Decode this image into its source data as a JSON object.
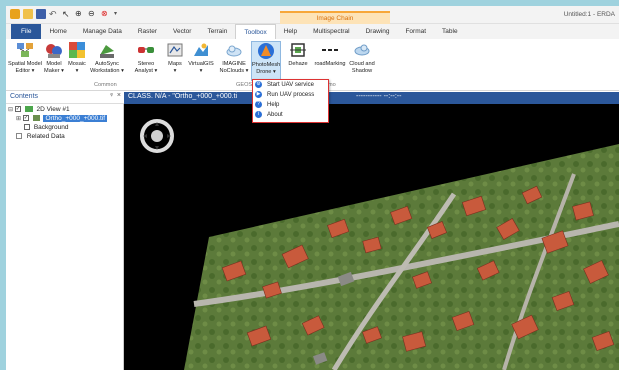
{
  "title_bar": {
    "context_tab": "Image Chain",
    "doc_title": "Untitled:1 - ERDA"
  },
  "tabs": [
    "File",
    "Home",
    "Manage Data",
    "Raster",
    "Vector",
    "Terrain",
    "Toolbox",
    "Help",
    "Multispectral",
    "Drawing",
    "Format",
    "Table"
  ],
  "active_tab": "Toolbox",
  "ribbon": {
    "buttons": [
      {
        "line1": "Spatial Model",
        "line2": "Editor ▾"
      },
      {
        "line1": "Model",
        "line2": "Maker ▾"
      },
      {
        "line1": "Mosaic",
        "line2": "▾"
      },
      {
        "line1": "AutoSync",
        "line2": "Workstation ▾"
      },
      {
        "line1": "Stereo",
        "line2": "Analyst ▾"
      },
      {
        "line1": "Maps",
        "line2": "▾"
      },
      {
        "line1": "VirtualGIS",
        "line2": "▾"
      },
      {
        "line1": "IMAGINE",
        "line2": "NoClouds ▾"
      },
      {
        "line1": "PhotoMesh",
        "line2": "Drone ▾"
      },
      {
        "line1": "Dehaze",
        "line2": ""
      },
      {
        "line1": "roadMarking",
        "line2": ""
      },
      {
        "line1": "Cloud and",
        "line2": "Shadow"
      }
    ],
    "groups": {
      "common": "Common",
      "geos": "GEOS",
      "demo": "mo"
    }
  },
  "contents": {
    "title": "Contents",
    "pin": "ᵠ",
    "close": "×",
    "view": "2D View #1",
    "layer": "Ortho_+000_+000.tif",
    "background": "Background",
    "related": "Related Data"
  },
  "viewbar": {
    "title": "CLASS. N/A - \"Ortho_+000_+000.ti",
    "right": "----------- --:--:--"
  },
  "menu": {
    "items": [
      {
        "label": "Start UAV service",
        "icon": "gear-icon"
      },
      {
        "label": "Run UAV process",
        "icon": "play-icon"
      },
      {
        "label": "Help",
        "icon": "help-icon"
      },
      {
        "label": "About",
        "icon": "info-icon"
      }
    ]
  },
  "colors": {
    "accent": "#2b579a",
    "menu_border": "#dd3333",
    "context_tab": "#f7a739"
  }
}
